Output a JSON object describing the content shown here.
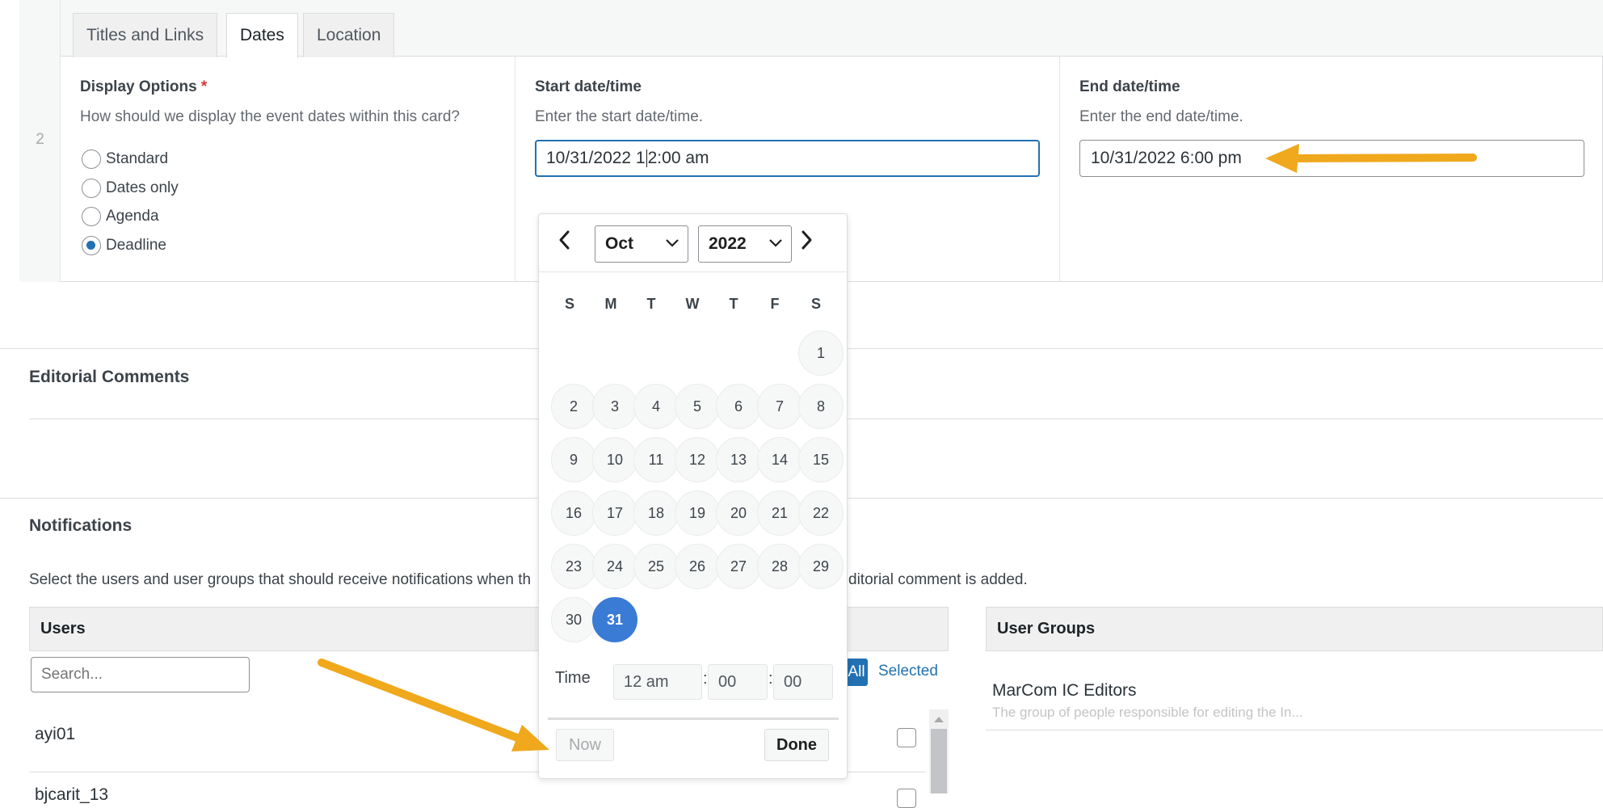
{
  "row": {
    "number": "2",
    "tabs": [
      {
        "label": "Titles and Links"
      },
      {
        "label": "Dates"
      },
      {
        "label": "Location"
      }
    ]
  },
  "display_options": {
    "label": "Display Options",
    "required_mark": "*",
    "description": "How should we display the event dates within this card?",
    "options": [
      {
        "label": "Standard",
        "checked": false
      },
      {
        "label": "Dates only",
        "checked": false
      },
      {
        "label": "Agenda",
        "checked": false
      },
      {
        "label": "Deadline",
        "checked": true
      }
    ]
  },
  "start": {
    "label": "Start date/time",
    "description": "Enter the start date/time.",
    "value_before_caret": "10/31/2022 1",
    "value_after_caret": "2:00 am"
  },
  "end": {
    "label": "End date/time",
    "description": "Enter the end date/time.",
    "value": "10/31/2022 6:00 pm"
  },
  "datepicker": {
    "month": "Oct",
    "year": "2022",
    "weekdays": [
      "S",
      "M",
      "T",
      "W",
      "T",
      "F",
      "S"
    ],
    "weeks": [
      [
        "",
        "",
        "",
        "",
        "",
        "",
        "1"
      ],
      [
        "2",
        "3",
        "4",
        "5",
        "6",
        "7",
        "8"
      ],
      [
        "9",
        "10",
        "11",
        "12",
        "13",
        "14",
        "15"
      ],
      [
        "16",
        "17",
        "18",
        "19",
        "20",
        "21",
        "22"
      ],
      [
        "23",
        "24",
        "25",
        "26",
        "27",
        "28",
        "29"
      ],
      [
        "30",
        "31",
        "",
        "",
        "",
        "",
        ""
      ]
    ],
    "selected_day": "31",
    "time_label": "Time",
    "hour": "12 am",
    "minute": "00",
    "second": "00",
    "now_label": "Now",
    "done_label": "Done"
  },
  "editorial": {
    "title": "Editorial Comments"
  },
  "notifications": {
    "title": "Notifications",
    "description_left": "Select the users and user groups that should receive notifications when th",
    "description_right": "ditorial comment is added.",
    "users_header": "Users",
    "search_placeholder": "Search...",
    "all_label": "All",
    "selected_label": "Selected",
    "users": [
      "ayi01",
      "bjcarit_13"
    ],
    "groups_header": "User Groups",
    "groups": [
      {
        "name": "MarCom IC Editors",
        "description": "The group of people responsible for editing the In..."
      }
    ]
  },
  "colors": {
    "accent": "#2271b1",
    "selected_day": "#3a7bd5",
    "annotation_arrow": "#f0a81c"
  }
}
